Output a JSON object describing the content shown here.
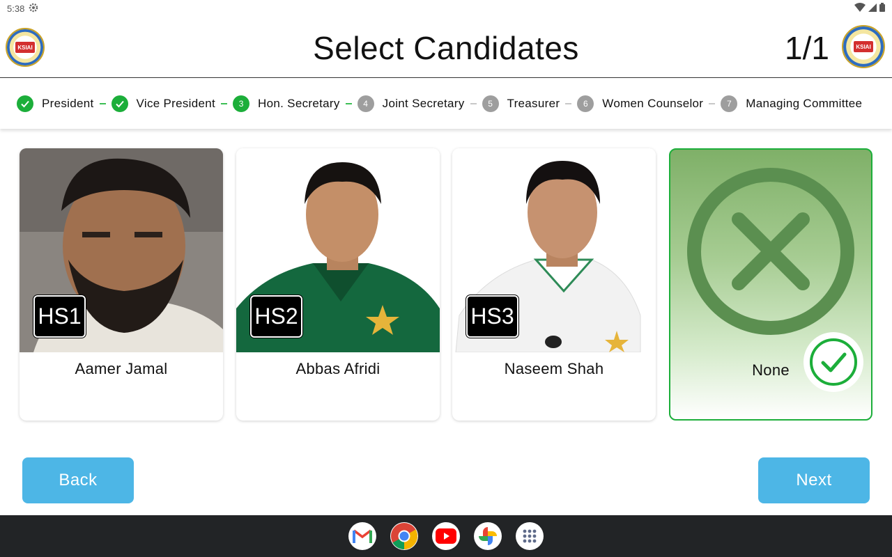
{
  "status_bar": {
    "time": "5:38",
    "icons": [
      "settings-icon",
      "wifi-icon",
      "signal-icon",
      "battery-icon"
    ]
  },
  "header": {
    "title": "Select Candidates",
    "counter": "1/1",
    "logo_text": "KSIAI"
  },
  "stepper": {
    "steps": [
      {
        "number": "1",
        "label": "President",
        "state": "done"
      },
      {
        "number": "2",
        "label": "Vice President",
        "state": "done"
      },
      {
        "number": "3",
        "label": "Hon. Secretary",
        "state": "active"
      },
      {
        "number": "4",
        "label": "Joint Secretary",
        "state": "pending"
      },
      {
        "number": "5",
        "label": "Treasurer",
        "state": "pending"
      },
      {
        "number": "6",
        "label": "Women Counselor",
        "state": "pending"
      },
      {
        "number": "7",
        "label": "Managing Committee",
        "state": "pending"
      }
    ]
  },
  "candidates": [
    {
      "code": "HS1",
      "name": "Aamer Jamal",
      "photo_bg": "#8a8580"
    },
    {
      "code": "HS2",
      "name": "Abbas Afridi",
      "photo_bg": "#ffffff"
    },
    {
      "code": "HS3",
      "name": "Naseem Shah",
      "photo_bg": "#ffffff"
    }
  ],
  "none_option": {
    "label": "None",
    "selected": true
  },
  "buttons": {
    "back": "Back",
    "next": "Next"
  },
  "taskbar": {
    "apps": [
      "gmail-icon",
      "chrome-icon",
      "youtube-icon",
      "photos-icon",
      "app-drawer-icon"
    ]
  },
  "colors": {
    "accent_green": "#1cae3a",
    "button_blue": "#4db6e6",
    "pending_grey": "#9e9e9e",
    "taskbar": "#222426"
  }
}
